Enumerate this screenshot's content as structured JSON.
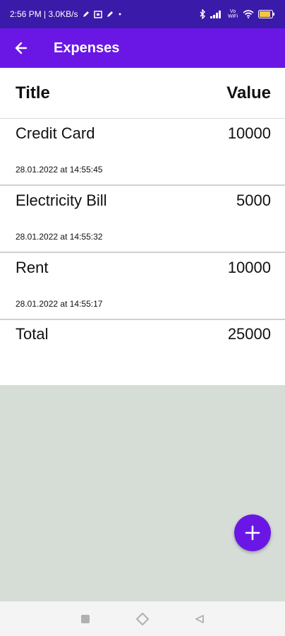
{
  "status_bar": {
    "left_text": "2:56 PM | 3.0KB/s",
    "right_icons": [
      "bluetooth-icon",
      "signal-icon",
      "vowifi-icon",
      "wifi-icon",
      "battery-icon"
    ],
    "vowifi_label": "Vo WiFi"
  },
  "app_bar": {
    "title": "Expenses",
    "color": "#6a17e6"
  },
  "table": {
    "header_title": "Title",
    "header_value": "Value",
    "items": [
      {
        "title": "Credit Card",
        "value": "10000",
        "timestamp": "28.01.2022 at 14:55:45"
      },
      {
        "title": "Electricity Bill",
        "value": "5000",
        "timestamp": "28.01.2022 at 14:55:32"
      },
      {
        "title": "Rent",
        "value": "10000",
        "timestamp": "28.01.2022 at 14:55:17"
      }
    ],
    "total_label": "Total",
    "total_value": "25000"
  },
  "fab": {
    "icon": "plus-icon",
    "color": "#6a17e6"
  },
  "nav_bar": {
    "buttons": [
      "square-icon",
      "diamond-home-icon",
      "triangle-back-icon"
    ]
  }
}
